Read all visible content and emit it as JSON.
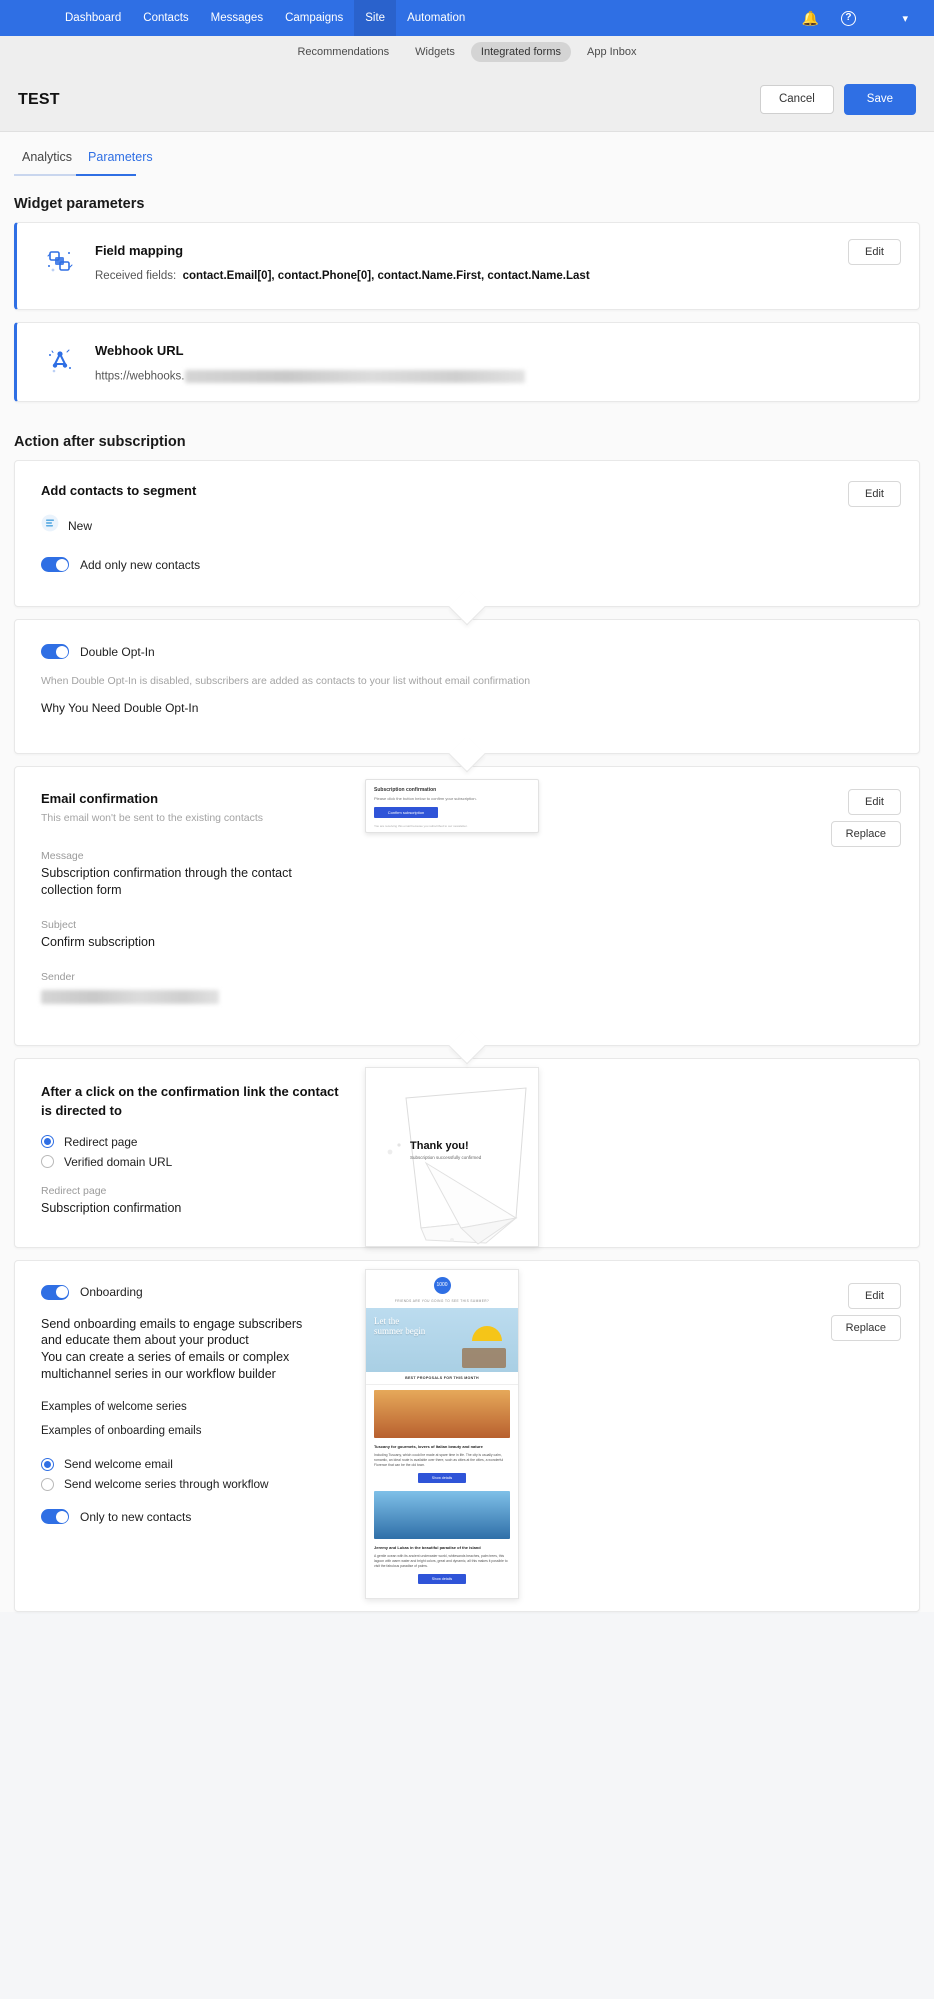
{
  "topnav": {
    "items": [
      {
        "label": "Dashboard",
        "active": false
      },
      {
        "label": "Contacts",
        "active": false
      },
      {
        "label": "Messages",
        "active": false
      },
      {
        "label": "Campaigns",
        "active": false
      },
      {
        "label": "Site",
        "active": true
      },
      {
        "label": "Automation",
        "active": false
      }
    ],
    "notifications_icon": "bell-icon",
    "help_icon": "help-icon",
    "account_caret": "chevron-down-icon"
  },
  "subnav": {
    "items": [
      {
        "label": "Recommendations",
        "active": false
      },
      {
        "label": "Widgets",
        "active": false
      },
      {
        "label": "Integrated forms",
        "active": true
      },
      {
        "label": "App Inbox",
        "active": false
      }
    ]
  },
  "titlebar": {
    "title": "TEST",
    "cancel_label": "Cancel",
    "save_label": "Save"
  },
  "tabs": [
    {
      "label": "Analytics",
      "active": false
    },
    {
      "label": "Parameters",
      "active": true
    }
  ],
  "widget_parameters": {
    "heading": "Widget parameters",
    "field_mapping": {
      "icon": "field-mapping-icon",
      "title": "Field mapping",
      "received_label": "Received fields:",
      "received_value": "contact.Email[0], contact.Phone[0], contact.Name.First, contact.Name.Last",
      "edit_label": "Edit"
    },
    "webhook": {
      "icon": "webhook-icon",
      "title": "Webhook URL",
      "url_prefix": "https://webhooks.",
      "url_redacted": true
    }
  },
  "action_after_subscription": {
    "heading": "Action after subscription",
    "segment": {
      "title": "Add contacts to segment",
      "segment_icon": "segment-icon",
      "segment_name": "New",
      "toggle_label": "Add only new contacts",
      "toggle_on": true,
      "edit_label": "Edit"
    },
    "double_opt_in": {
      "toggle_label": "Double Opt-In",
      "toggle_on": true,
      "note": "When Double Opt-In is disabled, subscribers are added as contacts to your list without email confirmation",
      "link_label": "Why You Need Double Opt-In"
    },
    "email_confirmation": {
      "title": "Email confirmation",
      "note": "This email won't be sent to the existing contacts",
      "message_label": "Message",
      "message_value": "Subscription confirmation through the contact collection form",
      "subject_label": "Subject",
      "subject_value": "Confirm subscription",
      "sender_label": "Sender",
      "sender_redacted": true,
      "edit_label": "Edit",
      "replace_label": "Replace",
      "preview": {
        "title": "Subscription confirmation",
        "body": "Please click the button below to confirm your subscription.",
        "button": "Confirm subscription",
        "footer": "You are receiving this email because you subscribed to our newsletter."
      }
    },
    "redirect": {
      "title": "After a click on the confirmation link the contact is directed to",
      "options": [
        {
          "label": "Redirect page",
          "selected": true
        },
        {
          "label": "Verified domain URL",
          "selected": false
        }
      ],
      "field_label": "Redirect page",
      "field_value": "Subscription confirmation",
      "preview": {
        "title": "Thank you!",
        "subtitle": "Subscription successfully confirmed"
      }
    },
    "onboarding": {
      "toggle_label": "Onboarding",
      "toggle_on": true,
      "description_1": "Send onboarding emails to engage subscribers and educate them about your product",
      "description_2": "You can create a series of emails or complex multichannel series in our workflow builder",
      "link_1": "Examples of welcome series",
      "link_2": "Examples of onboarding emails",
      "options": [
        {
          "label": "Send welcome email",
          "selected": true
        },
        {
          "label": "Send welcome series through workflow",
          "selected": false
        }
      ],
      "toggle2_label": "Only to new contacts",
      "toggle2_on": true,
      "edit_label": "Edit",
      "replace_label": "Replace",
      "preview": {
        "logo": "1000",
        "tagline": "FRIENDS ARE YOU GOING TO SEE THIS SUMMER?",
        "hero_line1": "Let the",
        "hero_line2": "summer begin",
        "section_title": "BEST PROPOSALS FOR THIS MONTH",
        "item1_title": "Tuscany for gourmets, lovers of Italian beauty and nature",
        "item1_body": "Including Tuscany, which could be made at spare time in life. The city is usually calm, romantic, an ideal route is available over there, such as cities at the cities, a wonderful Florence that can be the old town.",
        "item1_button": "Show details",
        "item2_title": "Jeremy and Lukas in the beautiful paradise of the island",
        "item2_body": "A gentle ocean with its ancient underwater world, whitesands beaches, palm trees, this lagoon with warm water and bright colors, great and dynamic, all this makes it possible to visit the fabulous paradise of palms.",
        "item2_button": "Show details"
      }
    }
  },
  "colors": {
    "brand_blue": "#2f6fe4",
    "nav_active": "#2a62cc",
    "page_bg": "#fafafa",
    "card_border": "#e8e8e8"
  }
}
